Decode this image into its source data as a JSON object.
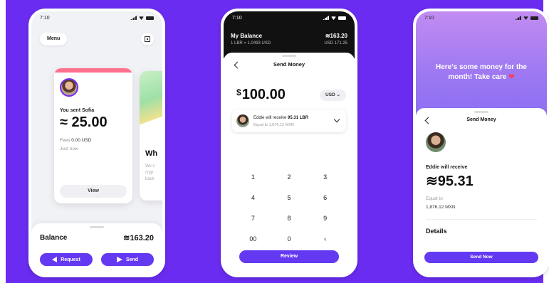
{
  "status_time": "7:10",
  "phone1": {
    "menu_label": "Menu",
    "card": {
      "sent_label": "You sent Sofia",
      "amount": "≈ 25.00",
      "fees_label": "Fees",
      "fees_value": "0.00 USD",
      "time": "Just now",
      "view_label": "View"
    },
    "peek": {
      "title": "Wh",
      "lines": [
        "We c",
        "cryp",
        "back"
      ]
    },
    "balance_label": "Balance",
    "balance_value": "≋163.20",
    "request_label": "Request",
    "send_label": "Send"
  },
  "phone2": {
    "balance_title": "My Balance",
    "balance_sub": "1 LBR = 1.0493 USD",
    "balance_value": "≋163.20",
    "balance_usd": "USD 171.25",
    "title": "Send Money",
    "currency_symbol": "$",
    "amount": "100.00",
    "currency": "USD",
    "recipient_prefix": "Eddie will receive",
    "recipient_amount": "95.31 LBR",
    "equal_to": "Equal to 1,876.12 MXN",
    "keys": [
      "1",
      "2",
      "3",
      "4",
      "5",
      "6",
      "7",
      "8",
      "9",
      "00",
      "0",
      "‹"
    ],
    "review_label": "Review"
  },
  "phone3": {
    "note": "Here's some money for the month! Take care",
    "title": "Send Money",
    "receive_label": "Eddie will receive",
    "receive_amount": "≋95.31",
    "equal_label": "Equal to",
    "equal_value": "1,876.12 MXN",
    "details_label": "Details",
    "send_now_label": "Send Now"
  }
}
